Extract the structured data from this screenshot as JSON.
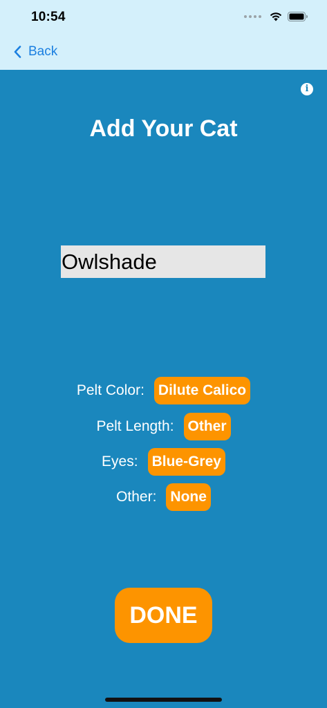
{
  "status_bar": {
    "time": "10:54"
  },
  "nav": {
    "back_label": "Back"
  },
  "info_icon_glyph": "i",
  "title": "Add Your Cat",
  "name_field": {
    "value": "Owlshade"
  },
  "attributes": [
    {
      "label": "Pelt Color:",
      "value": "Dilute Calico"
    },
    {
      "label": "Pelt Length:",
      "value": "Other"
    },
    {
      "label": "Eyes:",
      "value": "Blue-Grey"
    },
    {
      "label": "Other:",
      "value": "None"
    }
  ],
  "done_label": "DONE",
  "colors": {
    "background": "#1a87bd",
    "nav_bar": "#d4f0fb",
    "accent_orange": "#fd9400",
    "link_blue": "#1a7fe0"
  }
}
